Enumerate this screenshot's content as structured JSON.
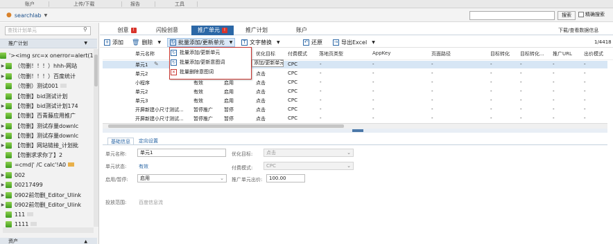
{
  "menu": {
    "items": [
      "账户",
      "上传/下载",
      "报告",
      "工具"
    ]
  },
  "user": {
    "name": "searchlab"
  },
  "search": {
    "button": "搜索",
    "exact_label": "精确搜索"
  },
  "sidebar": {
    "search_placeholder": "查找计划单元",
    "header": "推广计划",
    "items": [
      {
        "label": "'><img src=x onerror=alert(1)>"
      },
      {
        "label": "（勿删！！！）hhh-网站"
      },
      {
        "label": "（勿删！！！）百度统计"
      },
      {
        "label": "（勿删）测试001"
      },
      {
        "label": "【勿删】bid测试计划"
      },
      {
        "label": "【勿删】bid测试计划174"
      },
      {
        "label": "【勿删】百青藤应用推广"
      },
      {
        "label": "【勿删】测试存量downlc"
      },
      {
        "label": "【勿删】测试存量downlc"
      },
      {
        "label": "【勿删】网站链接_计划批"
      },
      {
        "label": "【勿删求求你了】2"
      },
      {
        "label": "=cmd|' /C calc'!A0"
      },
      {
        "label": "002"
      },
      {
        "label": "00217499"
      },
      {
        "label": "0902前勿删_Editor_Ulink"
      },
      {
        "label": "0902前勿删_Editor_Ulink"
      },
      {
        "label": "111"
      },
      {
        "label": "1111"
      }
    ],
    "footer": "资产"
  },
  "tabs": [
    {
      "label": "创意",
      "badge": "!"
    },
    {
      "label": "闪投创意",
      "badge": ""
    },
    {
      "label": "推广单元",
      "badge": "!"
    },
    {
      "label": "推广计划",
      "badge": ""
    },
    {
      "label": "账户",
      "badge": ""
    }
  ],
  "download_view": "下载/查看数据信息",
  "toolbar": {
    "add": "添加",
    "delete": "删除",
    "batch": "批量添加/更新单元",
    "text_replace": "文字替换",
    "restore": "还原",
    "export": "导出Excel",
    "page": "1/4418"
  },
  "dropdown": {
    "items": [
      "批量添加/更新单元",
      "批量添加/更新意图词",
      "批量删除意图词"
    ],
    "tooltip": "添加/更新单元"
  },
  "grid": {
    "columns": [
      "单元名称",
      "优化目标",
      "付费模式",
      "落地页类型",
      "AppKey",
      "页面路径",
      "目标转化",
      "目标转化...",
      "推广URL",
      "出价模式"
    ],
    "rows": [
      {
        "name": "单元1",
        "status": "",
        "state": "",
        "target": "点击",
        "pay": "CPC",
        "rest": "-"
      },
      {
        "name": "单元2",
        "status": "",
        "state": "",
        "target": "点击",
        "pay": "CPC",
        "rest": "-"
      },
      {
        "name": "小程序",
        "status": "有效",
        "state": "启用",
        "target": "点击",
        "pay": "CPC",
        "rest": "-"
      },
      {
        "name": "单元2",
        "status": "有效",
        "state": "启用",
        "target": "点击",
        "pay": "CPC",
        "rest": "-"
      },
      {
        "name": "单元3",
        "status": "有效",
        "state": "启用",
        "target": "点击",
        "pay": "CPC",
        "rest": "-"
      },
      {
        "name": "开屏新建小尺寸测试...",
        "status": "暂停推广",
        "state": "暂停",
        "target": "点击",
        "pay": "CPC",
        "rest": "-"
      },
      {
        "name": "开屏新建小尺寸测试...",
        "status": "暂停推广",
        "state": "暂停",
        "target": "点击",
        "pay": "CPC",
        "rest": "-"
      }
    ]
  },
  "detail": {
    "tabs": [
      "基础信息",
      "定向设置"
    ],
    "name_label": "单元名称:",
    "name_value": "单元1",
    "status_label": "单元状态:",
    "status_value": "有效",
    "toggle_label": "启用/暂停:",
    "toggle_value": "启用",
    "opt_label": "优化目标:",
    "opt_value": "点击",
    "pay_label": "付费模式:",
    "pay_value": "CPC",
    "bid_label": "推广单元出价:",
    "bid_value": "100.00",
    "scope_label": "投放范围:",
    "scope_value": "百度信息流"
  },
  "colors": {
    "accent": "#2b67a6",
    "badge": "#d8342b",
    "selected_row": "#d7e6f5"
  }
}
